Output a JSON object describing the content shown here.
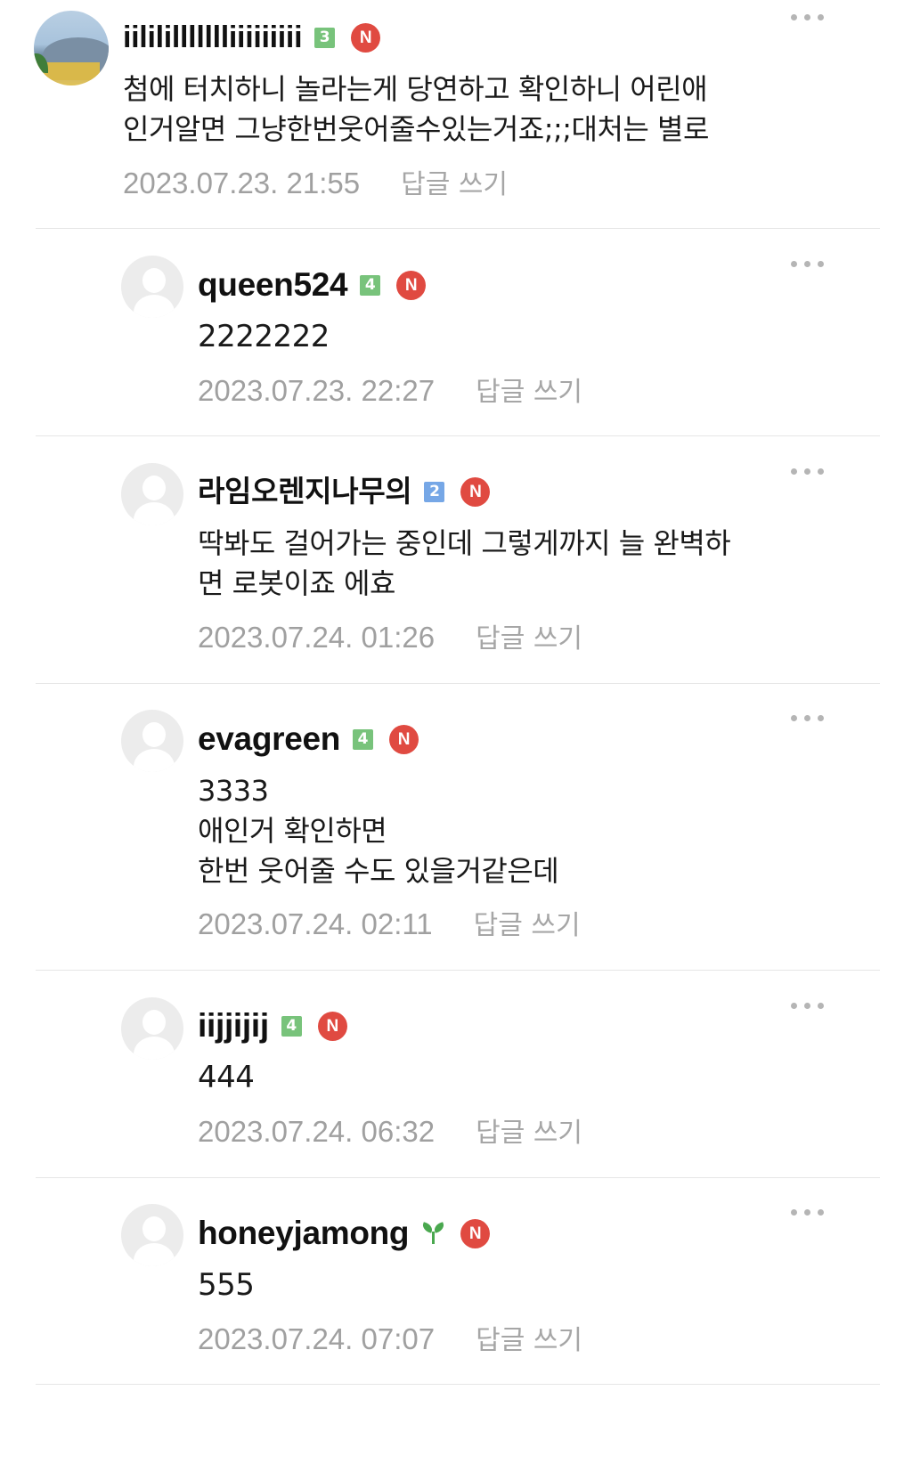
{
  "comments": [
    {
      "username": "iililillllllliiiiiiiii",
      "level": "3",
      "badge": "N",
      "text": "첨에 터치하니 놀라는게 당연하고 확인하니 어린애\n인거알면 그냥한번웃어줄수있는거죠;;;대처는 별로",
      "date": "2023.07.23. 21:55",
      "reply_label": "답글 쓰기"
    },
    {
      "username": "queen524",
      "level": "4",
      "badge": "N",
      "text": "2222222",
      "date": "2023.07.23. 22:27",
      "reply_label": "답글 쓰기"
    },
    {
      "username": "라임오렌지나무의",
      "level": "2",
      "badge": "N",
      "text": "딱봐도 걸어가는 중인데 그렇게까지 늘 완벽하\n면 로봇이죠 에효",
      "date": "2023.07.24. 01:26",
      "reply_label": "답글 쓰기"
    },
    {
      "username": "evagreen",
      "level": "4",
      "badge": "N",
      "text": "3333\n애인거 확인하면\n한번 웃어줄 수도 있을거같은데",
      "date": "2023.07.24. 02:11",
      "reply_label": "답글 쓰기"
    },
    {
      "username": "iijjijij",
      "level": "4",
      "badge": "N",
      "text": "444",
      "date": "2023.07.24. 06:32",
      "reply_label": "답글 쓰기"
    },
    {
      "username": "honeyjamong",
      "level_icon": "sprout-icon",
      "badge": "N",
      "text": "555",
      "date": "2023.07.24. 07:07",
      "reply_label": "답글 쓰기"
    }
  ],
  "colors": {
    "badge_red": "#e04a41",
    "level_green": "#78c37b",
    "level_blue": "#76a7e6",
    "meta_gray": "#a0a0a0"
  }
}
